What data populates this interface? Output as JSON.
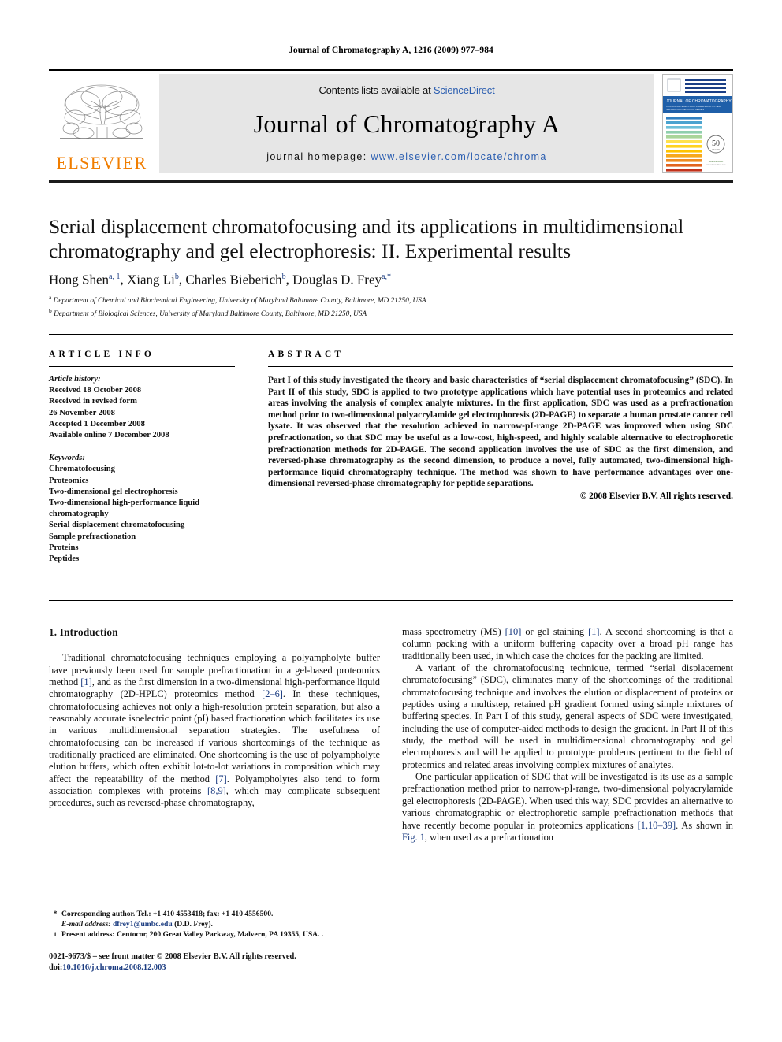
{
  "running_head": "Journal of Chromatography A, 1216 (2009) 977–984",
  "masthead": {
    "publisher_logo_text": "ELSEVIER",
    "contents_prefix": "Contents lists available at ",
    "contents_link": "ScienceDirect",
    "journal_name": "Journal of Chromatography A",
    "homepage_prefix": "journal homepage: ",
    "homepage_url": "www.elsevier.com/locate/chroma",
    "cover": {
      "title_line": "JOURNAL OF CHROMATOGRAPHY A",
      "badge_number": "50",
      "badge_sub": "YEARS",
      "accent_blue": "#1f5fa9",
      "band_colors": [
        "#1b3f86",
        "#1b3f86",
        "#1b3f86",
        "#1b3f86",
        "#2f7fc1",
        "#4aa3d0",
        "#6cbfd9",
        "#8fcfae",
        "#a9d59a",
        "#ffe14d",
        "#ffd21f",
        "#ffc400",
        "#f7a81b",
        "#ef8b20",
        "#e2641f",
        "#d4471d",
        "#c2331b"
      ]
    }
  },
  "article": {
    "title": "Serial displacement chromatofocusing and its applications in multidimensional chromatography and gel electrophoresis: II. Experimental results",
    "authors_html": "Hong Shen<sup>a, 1</sup>, Xiang Li<sup>b</sup>, Charles Bieberich<sup>b</sup>, Douglas D. Frey<sup>a,*</sup>",
    "affiliations": [
      "Department of Chemical and Biochemical Engineering, University of Maryland Baltimore County, Baltimore, MD 21250, USA",
      "Department of Biological Sciences, University of Maryland Baltimore County, Baltimore, MD 21250, USA"
    ],
    "affiliation_marks": [
      "a",
      "b"
    ]
  },
  "article_info": {
    "heading": "ARTICLE INFO",
    "history_label": "Article history:",
    "history": [
      "Received 18 October 2008",
      "Received in revised form",
      "26 November 2008",
      "Accepted 1 December 2008",
      "Available online 7 December 2008"
    ],
    "keywords_label": "Keywords:",
    "keywords": [
      "Chromatofocusing",
      "Proteomics",
      "Two-dimensional gel electrophoresis",
      "Two-dimensional high-performance liquid chromatography",
      "Serial displacement chromatofocusing",
      "Sample prefractionation",
      "Proteins",
      "Peptides"
    ]
  },
  "abstract": {
    "heading": "ABSTRACT",
    "text": "Part I of this study investigated the theory and basic characteristics of “serial displacement chromatofocusing” (SDC). In Part II of this study, SDC is applied to two prototype applications which have potential uses in proteomics and related areas involving the analysis of complex analyte mixtures. In the first application, SDC was used as a prefractionation method prior to two-dimensional polyacrylamide gel electrophoresis (2D-PAGE) to separate a human prostate cancer cell lysate. It was observed that the resolution achieved in narrow-pI-range 2D-PAGE was improved when using SDC prefractionation, so that SDC may be useful as a low-cost, high-speed, and highly scalable alternative to electrophoretic prefractionation methods for 2D-PAGE. The second application involves the use of SDC as the first dimension, and reversed-phase chromatography as the second dimension, to produce a novel, fully automated, two-dimensional high-performance liquid chromatography technique. The method was shown to have performance advantages over one-dimensional reversed-phase chromatography for peptide separations.",
    "copyright": "© 2008 Elsevier B.V. All rights reserved."
  },
  "body": {
    "section_heading": "1. Introduction",
    "left_paragraphs": [
      "Traditional chromatofocusing techniques employing a polyampholyte buffer have previously been used for sample prefractionation in a gel-based proteomics method [1], and as the first dimension in a two-dimensional high-performance liquid chromatography (2D-HPLC) proteomics method [2–6]. In these techniques, chromatofocusing achieves not only a high-resolution protein separation, but also a reasonably accurate isoelectric point (pI) based fractionation which facilitates its use in various multidimensional separation strategies. The usefulness of chromatofocusing can be increased if various shortcomings of the technique as traditionally practiced are eliminated. One shortcoming is the use of polyampholyte elution buffers, which often exhibit lot-to-lot variations in composition which may affect the repeatability of the method [7]. Polyampholytes also tend to form association complexes with proteins [8,9], which may complicate subsequent procedures, such as reversed-phase chromatography,"
    ],
    "right_paragraphs": [
      "mass spectrometry (MS) [10] or gel staining [1]. A second shortcoming is that a column packing with a uniform buffering capacity over a broad pH range has traditionally been used, in which case the choices for the packing are limited.",
      "A variant of the chromatofocusing technique, termed “serial displacement chromatofocusing” (SDC), eliminates many of the shortcomings of the traditional chromatofocusing technique and involves the elution or displacement of proteins or peptides using a multistep, retained pH gradient formed using simple mixtures of buffering species. In Part I of this study, general aspects of SDC were investigated, including the use of computer-aided methods to design the gradient. In Part II of this study, the method will be used in multidimensional chromatography and gel electrophoresis and will be applied to prototype problems pertinent to the field of proteomics and related areas involving complex mixtures of analytes.",
      "One particular application of SDC that will be investigated is its use as a sample prefractionation method prior to narrow-pI-range, two-dimensional polyacrylamide gel electrophoresis (2D-PAGE). When used this way, SDC provides an alternative to various chromatographic or electrophoretic sample prefractionation methods that have recently become popular in proteomics applications [1,10–39]. As shown in Fig. 1, when used as a prefractionation"
    ]
  },
  "footnotes": {
    "corresponding_mark": "*",
    "corresponding_text": "Corresponding author. Tel.: +1 410 4553418; fax: +1 410 4556500.",
    "email_label": "E-mail address:",
    "email": "dfrey1@umbc.edu",
    "email_owner": "(D.D. Frey).",
    "present_mark": "1",
    "present_text": "Present address: Centocor, 200 Great Valley Parkway, Malvern, PA 19355, USA. ."
  },
  "colophon": {
    "line1": "0021-9673/$ – see front matter © 2008 Elsevier B.V. All rights reserved.",
    "doi_label": "doi:",
    "doi": "10.1016/j.chroma.2008.12.003"
  }
}
